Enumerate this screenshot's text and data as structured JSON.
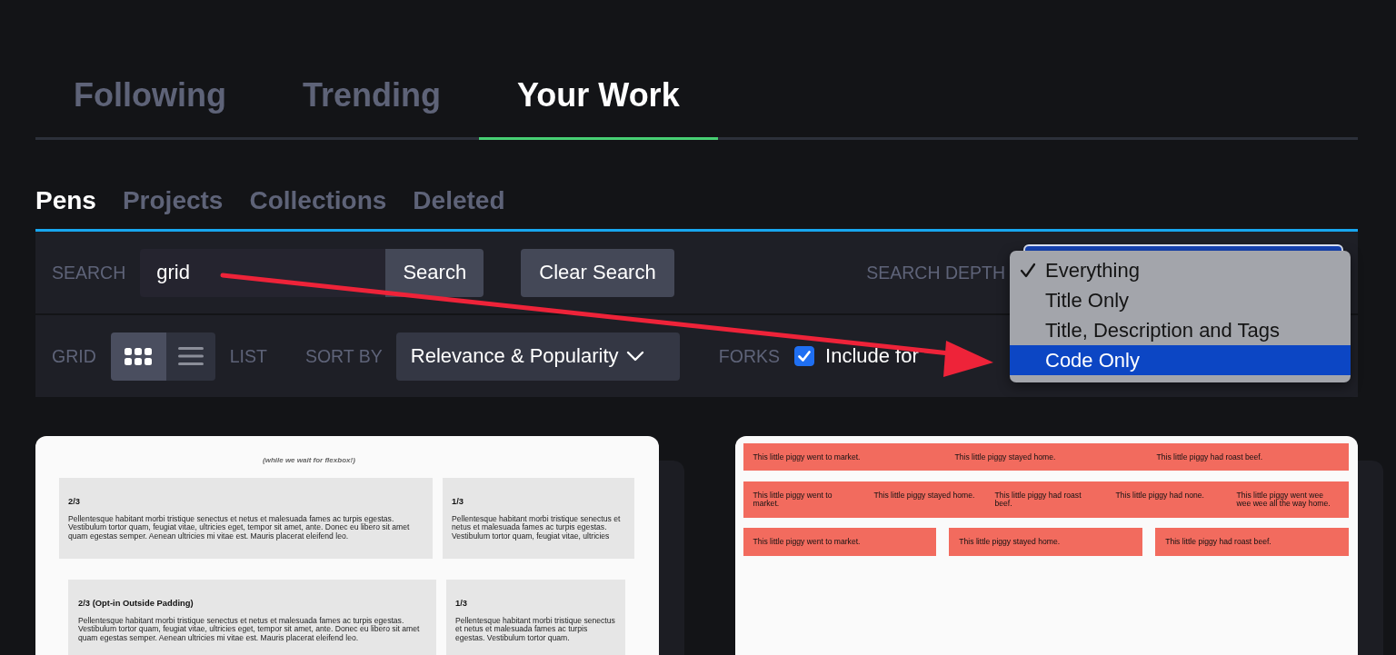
{
  "main_tabs": [
    {
      "label": "Following",
      "selected": false
    },
    {
      "label": "Trending",
      "selected": false
    },
    {
      "label": "Your Work",
      "selected": true
    }
  ],
  "sub_tabs": [
    {
      "label": "Pens",
      "selected": true
    },
    {
      "label": "Projects",
      "selected": false
    },
    {
      "label": "Collections",
      "selected": false
    },
    {
      "label": "Deleted",
      "selected": false
    }
  ],
  "search_row": {
    "search_label": "SEARCH",
    "search_field": {
      "value": "grid"
    },
    "search_button": "Search",
    "clear_button": "Clear Search",
    "depth_label": "SEARCH DEPTH",
    "depth_menu": {
      "options": [
        {
          "label": "Everything",
          "checked": true,
          "highlighted": false
        },
        {
          "label": "Title Only",
          "checked": false,
          "highlighted": false
        },
        {
          "label": "Title, Description and Tags",
          "checked": false,
          "highlighted": false
        },
        {
          "label": "Code Only",
          "checked": false,
          "highlighted": true
        }
      ]
    }
  },
  "view_row": {
    "grid_label": "GRID",
    "view_toggle": [
      {
        "kind": "grid",
        "selected": true
      },
      {
        "kind": "list",
        "selected": false
      }
    ],
    "list_label": "LIST",
    "sort_label": "SORT BY",
    "sort_select": {
      "value": "Relevance & Popularity"
    },
    "forks_label": "FORKS",
    "forks_checkbox": {
      "checked": true,
      "label": "Include for"
    }
  },
  "pens": [
    {
      "kind": "columns",
      "caption": "(while we wait for flexbox!)",
      "rows": [
        {
          "kind": "plain",
          "cells": [
            {
              "heading": "2/3",
              "text": "Pellentesque habitant morbi tristique senectus et netus et malesuada fames ac turpis egestas. Vestibulum tortor quam, feugiat vitae, ultricies eget, tempor sit amet, ante. Donec eu libero sit amet quam egestas semper. Aenean ultricies mi vitae est. Mauris placerat eleifend leo."
            },
            {
              "heading": "1/3",
              "text": "Pellentesque habitant morbi tristique senectus et netus et malesuada fames ac turpis egestas. Vestibulum tortor quam, feugiat vitae, ultricies"
            }
          ]
        },
        {
          "kind": "outside-padding",
          "cells": [
            {
              "heading": "2/3 (Opt-in Outside Padding)",
              "text": "Pellentesque habitant morbi tristique senectus et netus et malesuada fames ac turpis egestas. Vestibulum tortor quam, feugiat vitae, ultricies eget, tempor sit amet, ante. Donec eu libero sit amet quam egestas semper. Aenean ultricies mi vitae est. Mauris placerat eleifend leo."
            },
            {
              "heading": "1/3",
              "text": "Pellentesque habitant morbi tristique senectus et netus et malesuada fames ac turpis egestas. Vestibulum tortor quam."
            }
          ]
        }
      ]
    },
    {
      "kind": "strips",
      "strips": [
        {
          "kind": "joined",
          "phrases": [
            "This little piggy went to market.",
            "This little piggy stayed home.",
            "This little piggy had roast beef."
          ]
        },
        {
          "kind": "joined",
          "phrases": [
            "This little piggy went to market.",
            "This little piggy stayed home.",
            "This little piggy had roast beef.",
            "This little piggy had none.",
            "This little piggy went wee wee wee all the way home."
          ]
        },
        {
          "kind": "separate",
          "phrases": [
            "This little piggy went to market.",
            "This little piggy stayed home.",
            "This little piggy had roast beef."
          ]
        }
      ]
    }
  ],
  "annotations": [
    {
      "kind": "arrow"
    }
  ]
}
